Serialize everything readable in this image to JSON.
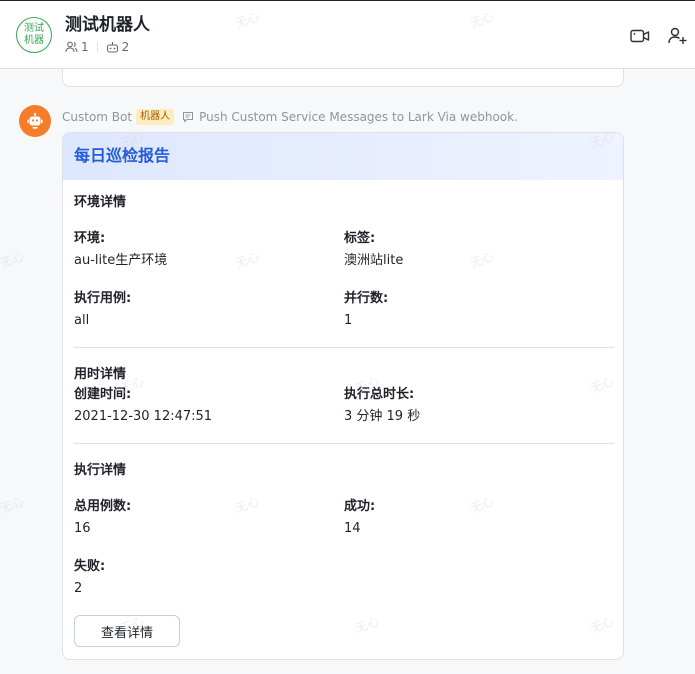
{
  "header": {
    "avatar_text": "测试机器",
    "title": "测试机器人",
    "member_count": "1",
    "bot_count": "2"
  },
  "message": {
    "sender": "Custom Bot",
    "badge": "机器人",
    "push_text": "Push Custom Service Messages to Lark Via webhook."
  },
  "card": {
    "title": "每日巡检报告",
    "sections": {
      "env": {
        "title": "环境详情",
        "env_label": "环境:",
        "env_value": "au-lite生产环境",
        "tag_label": "标签:",
        "tag_value": "澳洲站lite",
        "case_label": "执行用例:",
        "case_value": "all",
        "parallel_label": "并行数:",
        "parallel_value": "1"
      },
      "time": {
        "title": "用时详情",
        "created_label": "创建时间:",
        "created_value": "2021-12-30 12:47:51",
        "duration_label": "执行总时长:",
        "duration_value": "3 分钟 19 秒"
      },
      "exec": {
        "title": "执行详情",
        "total_label": "总用例数:",
        "total_value": "16",
        "success_label": "成功:",
        "success_value": "14",
        "fail_label": "失败:",
        "fail_value": "2"
      }
    },
    "button_label": "查看详情"
  },
  "watermark": "无心",
  "colors": {
    "card_title": "#245bdb",
    "bot_avatar": "#f57d29",
    "group_avatar": "#34a853",
    "badge_bg": "#fdecbe",
    "badge_text": "#a45d00"
  }
}
